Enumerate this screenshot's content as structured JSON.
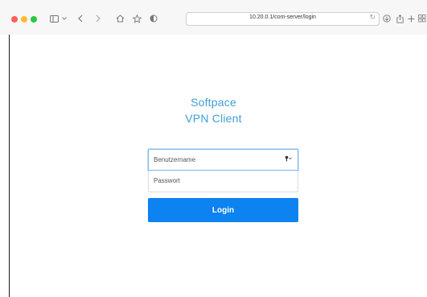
{
  "browser": {
    "url": "10.20.0.1/com-server/login",
    "icons": {
      "close": "close-dot",
      "minimize": "minimize-dot",
      "zoom": "zoom-dot",
      "sidebar": "sidebar-icon",
      "sidebar_chevron": "chevron-down-icon",
      "back": "back-arrow-icon",
      "forward": "forward-arrow-icon",
      "home": "home-icon",
      "bookmark": "star-icon",
      "privacy": "shield-icon",
      "reload": "reload-icon",
      "downloads": "download-icon",
      "share": "share-icon",
      "new_tab": "plus-icon",
      "tab_overview": "grid-icon"
    },
    "colors": {
      "close": "#ff5f57",
      "minimize": "#febc2e",
      "zoom": "#28c840"
    }
  },
  "page": {
    "title_line1": "Softpace",
    "title_line2": "VPN Client",
    "title_color": "#3ea0d8",
    "username_placeholder": "Benutzername",
    "password_placeholder": "Passwort",
    "login_label": "Login",
    "button_color": "#0d82f1",
    "key_icon": "key-icon"
  }
}
